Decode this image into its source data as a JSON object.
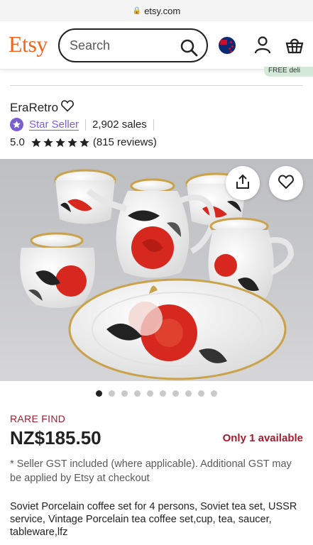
{
  "browser": {
    "url": "etsy.com"
  },
  "header": {
    "logo": "Etsy",
    "search_placeholder": "Search",
    "icons": [
      "search-icon",
      "nz-flag-icon",
      "user-icon",
      "cart-icon"
    ]
  },
  "banner": {
    "partial_text": "FREE deli"
  },
  "shop": {
    "name": "EraRetro",
    "badge": "Star Seller",
    "sales": "2,902 sales",
    "rating": "5.0",
    "stars": 5,
    "reviews": "(815 reviews)"
  },
  "gallery": {
    "image_count": 10,
    "active_index": 0,
    "actions": [
      "share-icon",
      "favorite-heart-icon"
    ]
  },
  "listing": {
    "tag": "RARE FIND",
    "price": "NZ$185.50",
    "availability": "Only 1 available",
    "gst_note": "* Seller GST included (where applicable). Additional GST may be applied by Etsy at checkout",
    "title": "Soviet Porcelain coffee set for 4 persons, Soviet tea set, USSR service, Vintage Porcelain tea coffee set,cup, tea, saucer, tableware,lfz"
  },
  "colors": {
    "brand": "#f1641e",
    "star_seller": "#7a5fd0",
    "alert": "#a61a2e"
  }
}
